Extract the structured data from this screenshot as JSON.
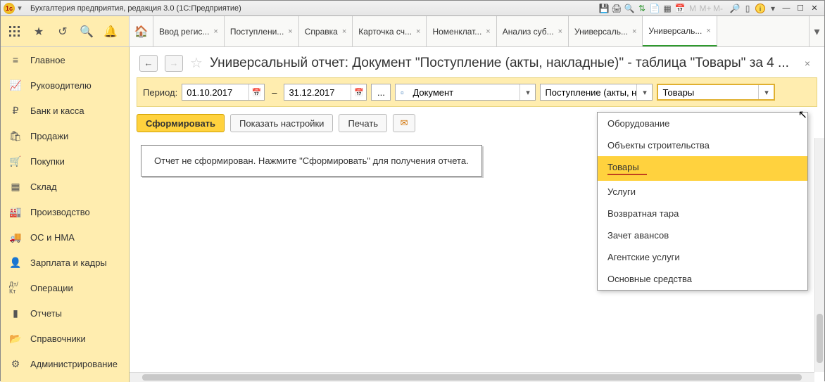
{
  "title": "Бухгалтерия предприятия, редакция 3.0  (1С:Предприятие)",
  "sidebar": {
    "items": [
      {
        "label": "Главное",
        "icon": "≡"
      },
      {
        "label": "Руководителю",
        "icon": "📈"
      },
      {
        "label": "Банк и касса",
        "icon": "₽"
      },
      {
        "label": "Продажи",
        "icon": "🛍"
      },
      {
        "label": "Покупки",
        "icon": "🛒"
      },
      {
        "label": "Склад",
        "icon": "▦"
      },
      {
        "label": "Производство",
        "icon": "🏭"
      },
      {
        "label": "ОС и НМА",
        "icon": "🚚"
      },
      {
        "label": "Зарплата и кадры",
        "icon": "👤"
      },
      {
        "label": "Операции",
        "icon": "Дт/Кт"
      },
      {
        "label": "Отчеты",
        "icon": "▮"
      },
      {
        "label": "Справочники",
        "icon": "📂"
      },
      {
        "label": "Администрирование",
        "icon": "⚙"
      }
    ]
  },
  "tabs": [
    {
      "label": "Ввод регис..."
    },
    {
      "label": "Поступлени..."
    },
    {
      "label": "Справка"
    },
    {
      "label": "Карточка сч..."
    },
    {
      "label": "Номенклат..."
    },
    {
      "label": "Анализ суб..."
    },
    {
      "label": "Универсаль..."
    },
    {
      "label": "Универсаль...",
      "active": true
    }
  ],
  "page": {
    "title": "Универсальный отчет: Документ \"Поступление (акты, накладные)\" - таблица \"Товары\" за 4 ..."
  },
  "filter": {
    "period_label": "Период:",
    "date_from": "01.10.2017",
    "date_to": "31.12.2017",
    "dash": "–",
    "dots": "...",
    "source_type": "Документ",
    "source_doc": "Поступление (акты, нак",
    "table": "Товары"
  },
  "actions": {
    "generate": "Сформировать",
    "show_settings": "Показать настройки",
    "print": "Печать"
  },
  "report": {
    "empty_text": "Отчет не сформирован. Нажмите \"Сформировать\" для получения отчета."
  },
  "dropdown": {
    "items": [
      "Оборудование",
      "Объекты строительства",
      "Товары",
      "Услуги",
      "Возвратная тара",
      "Зачет авансов",
      "Агентские услуги",
      "Основные средства"
    ],
    "selected": "Товары"
  }
}
